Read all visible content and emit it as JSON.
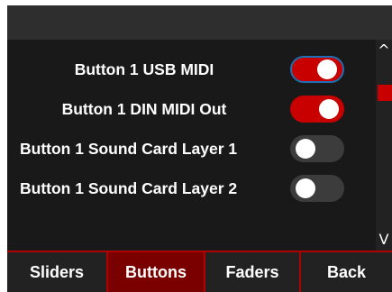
{
  "settings": [
    {
      "label": "Button 1 USB MIDI",
      "enabled": true,
      "focused": true
    },
    {
      "label": "Button 1 DIN MIDI Out",
      "enabled": true,
      "focused": false
    },
    {
      "label": "Button 1 Sound Card Layer 1",
      "enabled": false,
      "focused": false
    },
    {
      "label": "Button 1 Sound Card Layer 2",
      "enabled": false,
      "focused": false
    }
  ],
  "scroll": {
    "up_icon": "chevron-up-icon",
    "down_icon": "chevron-down-icon",
    "up_glyph": "^",
    "down_glyph": "V"
  },
  "tabs": [
    {
      "label": "Sliders",
      "active": false
    },
    {
      "label": "Buttons",
      "active": true
    },
    {
      "label": "Faders",
      "active": false
    },
    {
      "label": "Back",
      "active": false
    }
  ],
  "colors": {
    "accent": "#c80000",
    "active_tab": "#7a0000",
    "toggle_off": "#3c3c3c",
    "focus_ring": "#1e6fb4"
  }
}
